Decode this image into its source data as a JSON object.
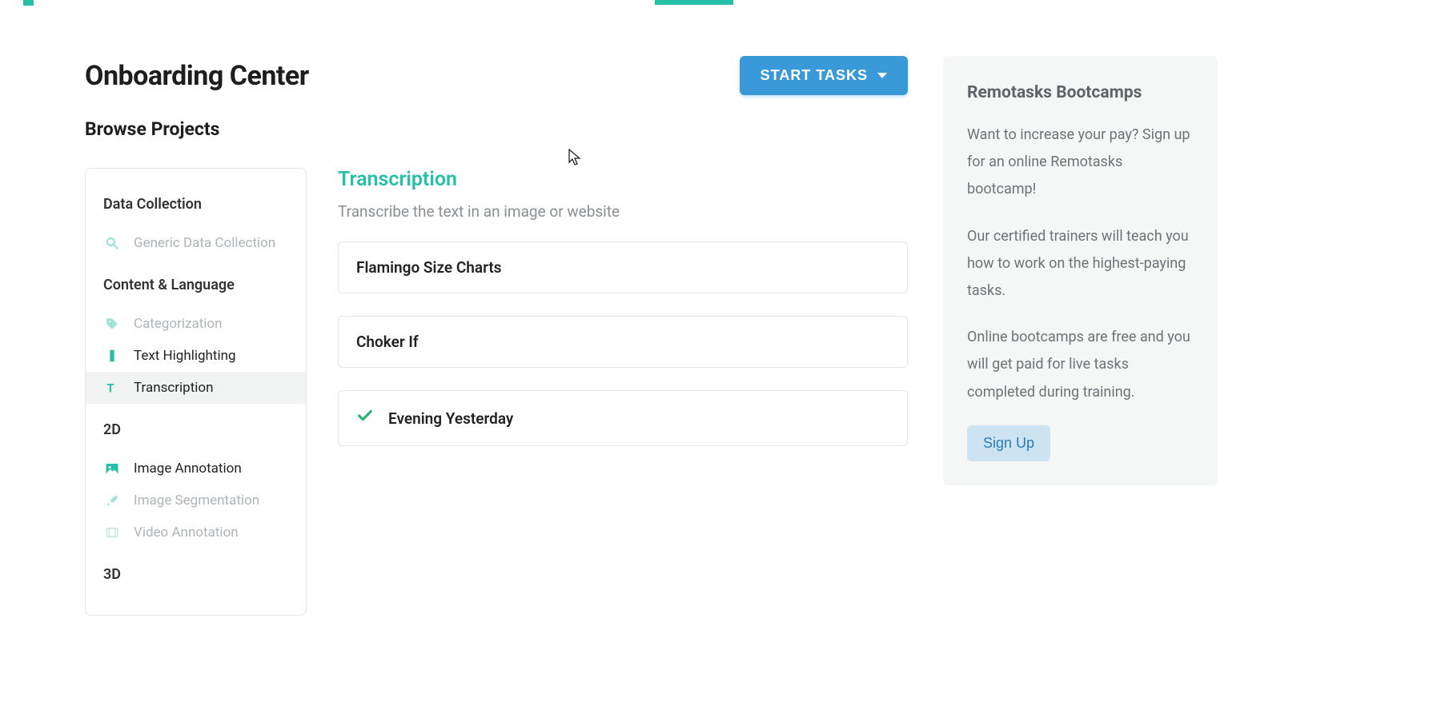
{
  "page": {
    "title": "Onboarding Center",
    "browse_label": "Browse Projects"
  },
  "buttons": {
    "start_tasks": "START TASKS",
    "sign_up": "Sign Up"
  },
  "sidebar": {
    "groups": {
      "data_collection": "Data Collection",
      "content_language": "Content & Language",
      "two_d": "2D",
      "three_d": "3D"
    },
    "items": {
      "generic_data_collection": "Generic Data Collection",
      "categorization": "Categorization",
      "text_highlighting": "Text Highlighting",
      "transcription": "Transcription",
      "image_annotation": "Image Annotation",
      "image_segmentation": "Image Segmentation",
      "video_annotation": "Video Annotation"
    }
  },
  "main": {
    "heading": "Transcription",
    "subheading": "Transcribe the text in an image or website",
    "tasks": [
      {
        "label": "Flamingo Size Charts",
        "completed": false
      },
      {
        "label": "Choker If",
        "completed": false
      },
      {
        "label": "Evening Yesterday",
        "completed": true
      }
    ]
  },
  "bootcamp": {
    "title": "Remotasks Bootcamps",
    "p1": "Want to increase your pay? Sign up for an online Remotasks bootcamp!",
    "p2": "Our certified trainers will teach you how to work on the highest-paying tasks.",
    "p3": "Online bootcamps are free and you will get paid for live tasks completed during training."
  }
}
